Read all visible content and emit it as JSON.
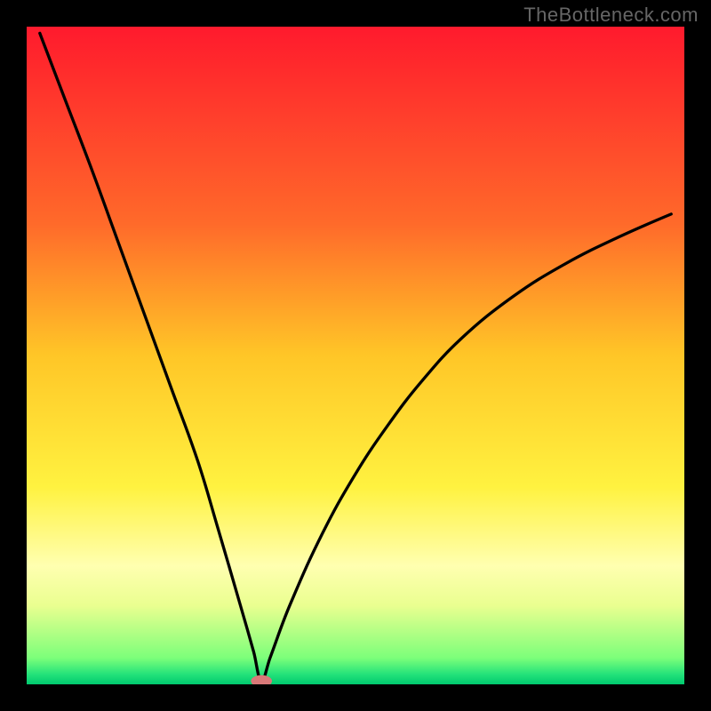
{
  "watermark": "TheBottleneck.com",
  "chart_data": {
    "type": "line",
    "title": "",
    "xlabel": "",
    "ylabel": "",
    "xlim": [
      0,
      100
    ],
    "ylim": [
      0,
      100
    ],
    "grid": false,
    "gradient_stops": [
      {
        "offset": 0.0,
        "color": "#ff1a2d"
      },
      {
        "offset": 0.3,
        "color": "#ff6a2a"
      },
      {
        "offset": 0.5,
        "color": "#ffc627"
      },
      {
        "offset": 0.7,
        "color": "#fff240"
      },
      {
        "offset": 0.82,
        "color": "#ffffb0"
      },
      {
        "offset": 0.88,
        "color": "#eaff90"
      },
      {
        "offset": 0.96,
        "color": "#7cff7a"
      },
      {
        "offset": 0.985,
        "color": "#23e27a"
      },
      {
        "offset": 1.0,
        "color": "#00c96f"
      }
    ],
    "series": [
      {
        "name": "curve",
        "x": [
          2,
          6,
          10,
          14,
          18,
          22,
          26,
          29,
          32.5,
          34.5,
          35.7,
          37,
          40,
          45,
          50,
          55,
          60,
          66,
          74,
          82,
          90,
          98
        ],
        "values": [
          99,
          88.5,
          78,
          67,
          56,
          45,
          34,
          24,
          12,
          5,
          0.5,
          4,
          12,
          23,
          32,
          39.5,
          46,
          52.5,
          59,
          64,
          68,
          71.5
        ]
      }
    ],
    "marker": {
      "name": "bottleneck-point",
      "x": 35.7,
      "y": 0.5,
      "rx": 1.6,
      "ry": 0.9,
      "color": "#d97878"
    }
  }
}
